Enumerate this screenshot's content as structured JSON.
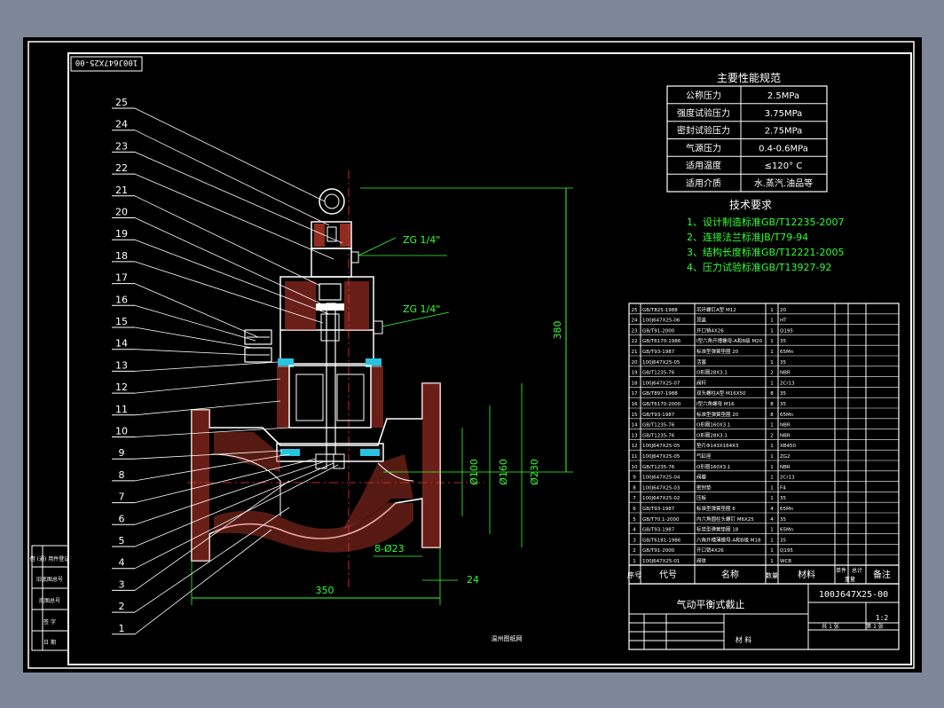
{
  "window": {
    "background": "#7d8797",
    "sheet_color": "#000000"
  },
  "drawing_code_rotated": "100J647X25-00",
  "performance": {
    "title": "主要性能规范",
    "rows": [
      {
        "label": "公称压力",
        "value": "2.5MPa"
      },
      {
        "label": "强度试验压力",
        "value": "3.75MPa"
      },
      {
        "label": "密封试验压力",
        "value": "2.75MPa"
      },
      {
        "label": "气源压力",
        "value": "0.4-0.6MPa"
      },
      {
        "label": "适用温度",
        "value": "≤120° C"
      },
      {
        "label": "适用介质",
        "value": "水.蒸汽.油品等"
      }
    ]
  },
  "tech": {
    "title": "技术要求",
    "items": [
      "1、设计制造标准GB/T12235-2007",
      "2、连接法兰标准JB/T79-94",
      "3、结构长度标准GB/T12221-2005",
      "4、压力试验标准GB/T13927-92"
    ]
  },
  "dimensions": {
    "height": "380",
    "length": "350",
    "d1": "Ø100",
    "d2": "Ø160",
    "d3": "Ø230",
    "bolts": "8-Ø23",
    "flange": "24",
    "port1": "ZG 1/4\"",
    "port2": "ZG 1/4\""
  },
  "balloons": [
    "25",
    "24",
    "23",
    "22",
    "21",
    "20",
    "19",
    "18",
    "17",
    "16",
    "15",
    "14",
    "13",
    "12",
    "11",
    "10",
    "9",
    "8",
    "7",
    "6",
    "5",
    "4",
    "3",
    "2",
    "1"
  ],
  "parts_list": {
    "rows": [
      {
        "no": "25",
        "code": "GB/T825-1988",
        "name": "吊环螺钉A型 M12",
        "qty": "1",
        "mat": "20"
      },
      {
        "no": "24",
        "code": "100J647X25-06",
        "name": "顶盖",
        "qty": "1",
        "mat": "HT"
      },
      {
        "no": "23",
        "code": "GB/T91-2000",
        "name": "开口销4X26",
        "qty": "1",
        "mat": "Q195"
      },
      {
        "no": "22",
        "code": "GB/T6170-1986",
        "name": "I型六角开槽螺母-A和B级 M20",
        "qty": "1",
        "mat": "35"
      },
      {
        "no": "21",
        "code": "GB/T93-1987",
        "name": "标准型弹簧垫圈 20",
        "qty": "1",
        "mat": "65Mn"
      },
      {
        "no": "20",
        "code": "100J647X25-05",
        "name": "活塞",
        "qty": "1",
        "mat": "35"
      },
      {
        "no": "19",
        "code": "GB/T1235-76",
        "name": "O形圈28X3.1",
        "qty": "2",
        "mat": "NBR"
      },
      {
        "no": "18",
        "code": "100J647X25-07",
        "name": "阀杆",
        "qty": "1",
        "mat": "2Cr13"
      },
      {
        "no": "17",
        "code": "GB/T897-1988",
        "name": "双头螺柱A型 M16X50",
        "qty": "8",
        "mat": "35"
      },
      {
        "no": "16",
        "code": "GB/T6170-2000",
        "name": "I型六角螺母 M16",
        "qty": "8",
        "mat": "35"
      },
      {
        "no": "15",
        "code": "GB/T93-1987",
        "name": "标准型弹簧垫圈 20",
        "qty": "8",
        "mat": "65Mn"
      },
      {
        "no": "14",
        "code": "GB/T1235-76",
        "name": "O形圈160X3.1",
        "qty": "1",
        "mat": "NBR"
      },
      {
        "no": "13",
        "code": "GB/T1235-76",
        "name": "O形圈28X3.1",
        "qty": "2",
        "mat": "NBR"
      },
      {
        "no": "12",
        "code": "100J647X25-05",
        "name": "垫片Φ143X164X3",
        "qty": "1",
        "mat": "XB450"
      },
      {
        "no": "11",
        "code": "100J647X25-05",
        "name": "气缸座",
        "qty": "1",
        "mat": "ZG2"
      },
      {
        "no": "10",
        "code": "GB/T1235-76",
        "name": "O形圈160X3.1",
        "qty": "1",
        "mat": "NBR"
      },
      {
        "no": "9",
        "code": "100J647X25-04",
        "name": "阀瓣",
        "qty": "1",
        "mat": "2Cr13"
      },
      {
        "no": "8",
        "code": "100J647X25-03",
        "name": "密封垫",
        "qty": "1",
        "mat": "F4"
      },
      {
        "no": "7",
        "code": "100J647X25-02",
        "name": "压板",
        "qty": "1",
        "mat": "35"
      },
      {
        "no": "6",
        "code": "GB/T93-1987",
        "name": "标准型弹簧垫圈 6",
        "qty": "4",
        "mat": "65Mn"
      },
      {
        "no": "5",
        "code": "GB/T70.1-2000",
        "name": "内六角圆柱头螺钉 M6X25",
        "qty": "4",
        "mat": "35"
      },
      {
        "no": "4",
        "code": "GB/T93-1987",
        "name": "标准型弹簧垫圈 18",
        "qty": "1",
        "mat": "65Mn"
      },
      {
        "no": "3",
        "code": "GB/T6181-1986",
        "name": "六角开槽薄螺母-A和B级 M18",
        "qty": "1",
        "mat": "35"
      },
      {
        "no": "2",
        "code": "GB/T91-2000",
        "name": "开口销4X26",
        "qty": "1",
        "mat": "Q195"
      },
      {
        "no": "1",
        "code": "100J647X25-01",
        "name": "阀体",
        "qty": "1",
        "mat": "WCB"
      }
    ],
    "header": {
      "no": "序号",
      "code": "代号",
      "name": "名称",
      "qty": "数量",
      "mat": "材料",
      "single": "单件",
      "total": "总计",
      "weight": "重量",
      "remark": "备注"
    }
  },
  "title_block": {
    "drawing_no": "100J647X25-00",
    "product_name": "气动平衡式截止",
    "scale": "1:2",
    "material_label": "材 料",
    "sheet_left": "共 1 张",
    "sheet_right": "第 1 张"
  },
  "bottom_caption": "温州图纸网",
  "left_strip": [
    "借 (通) 用件登记",
    "旧底图总号",
    "底图总号",
    "签 字",
    "日 期"
  ]
}
